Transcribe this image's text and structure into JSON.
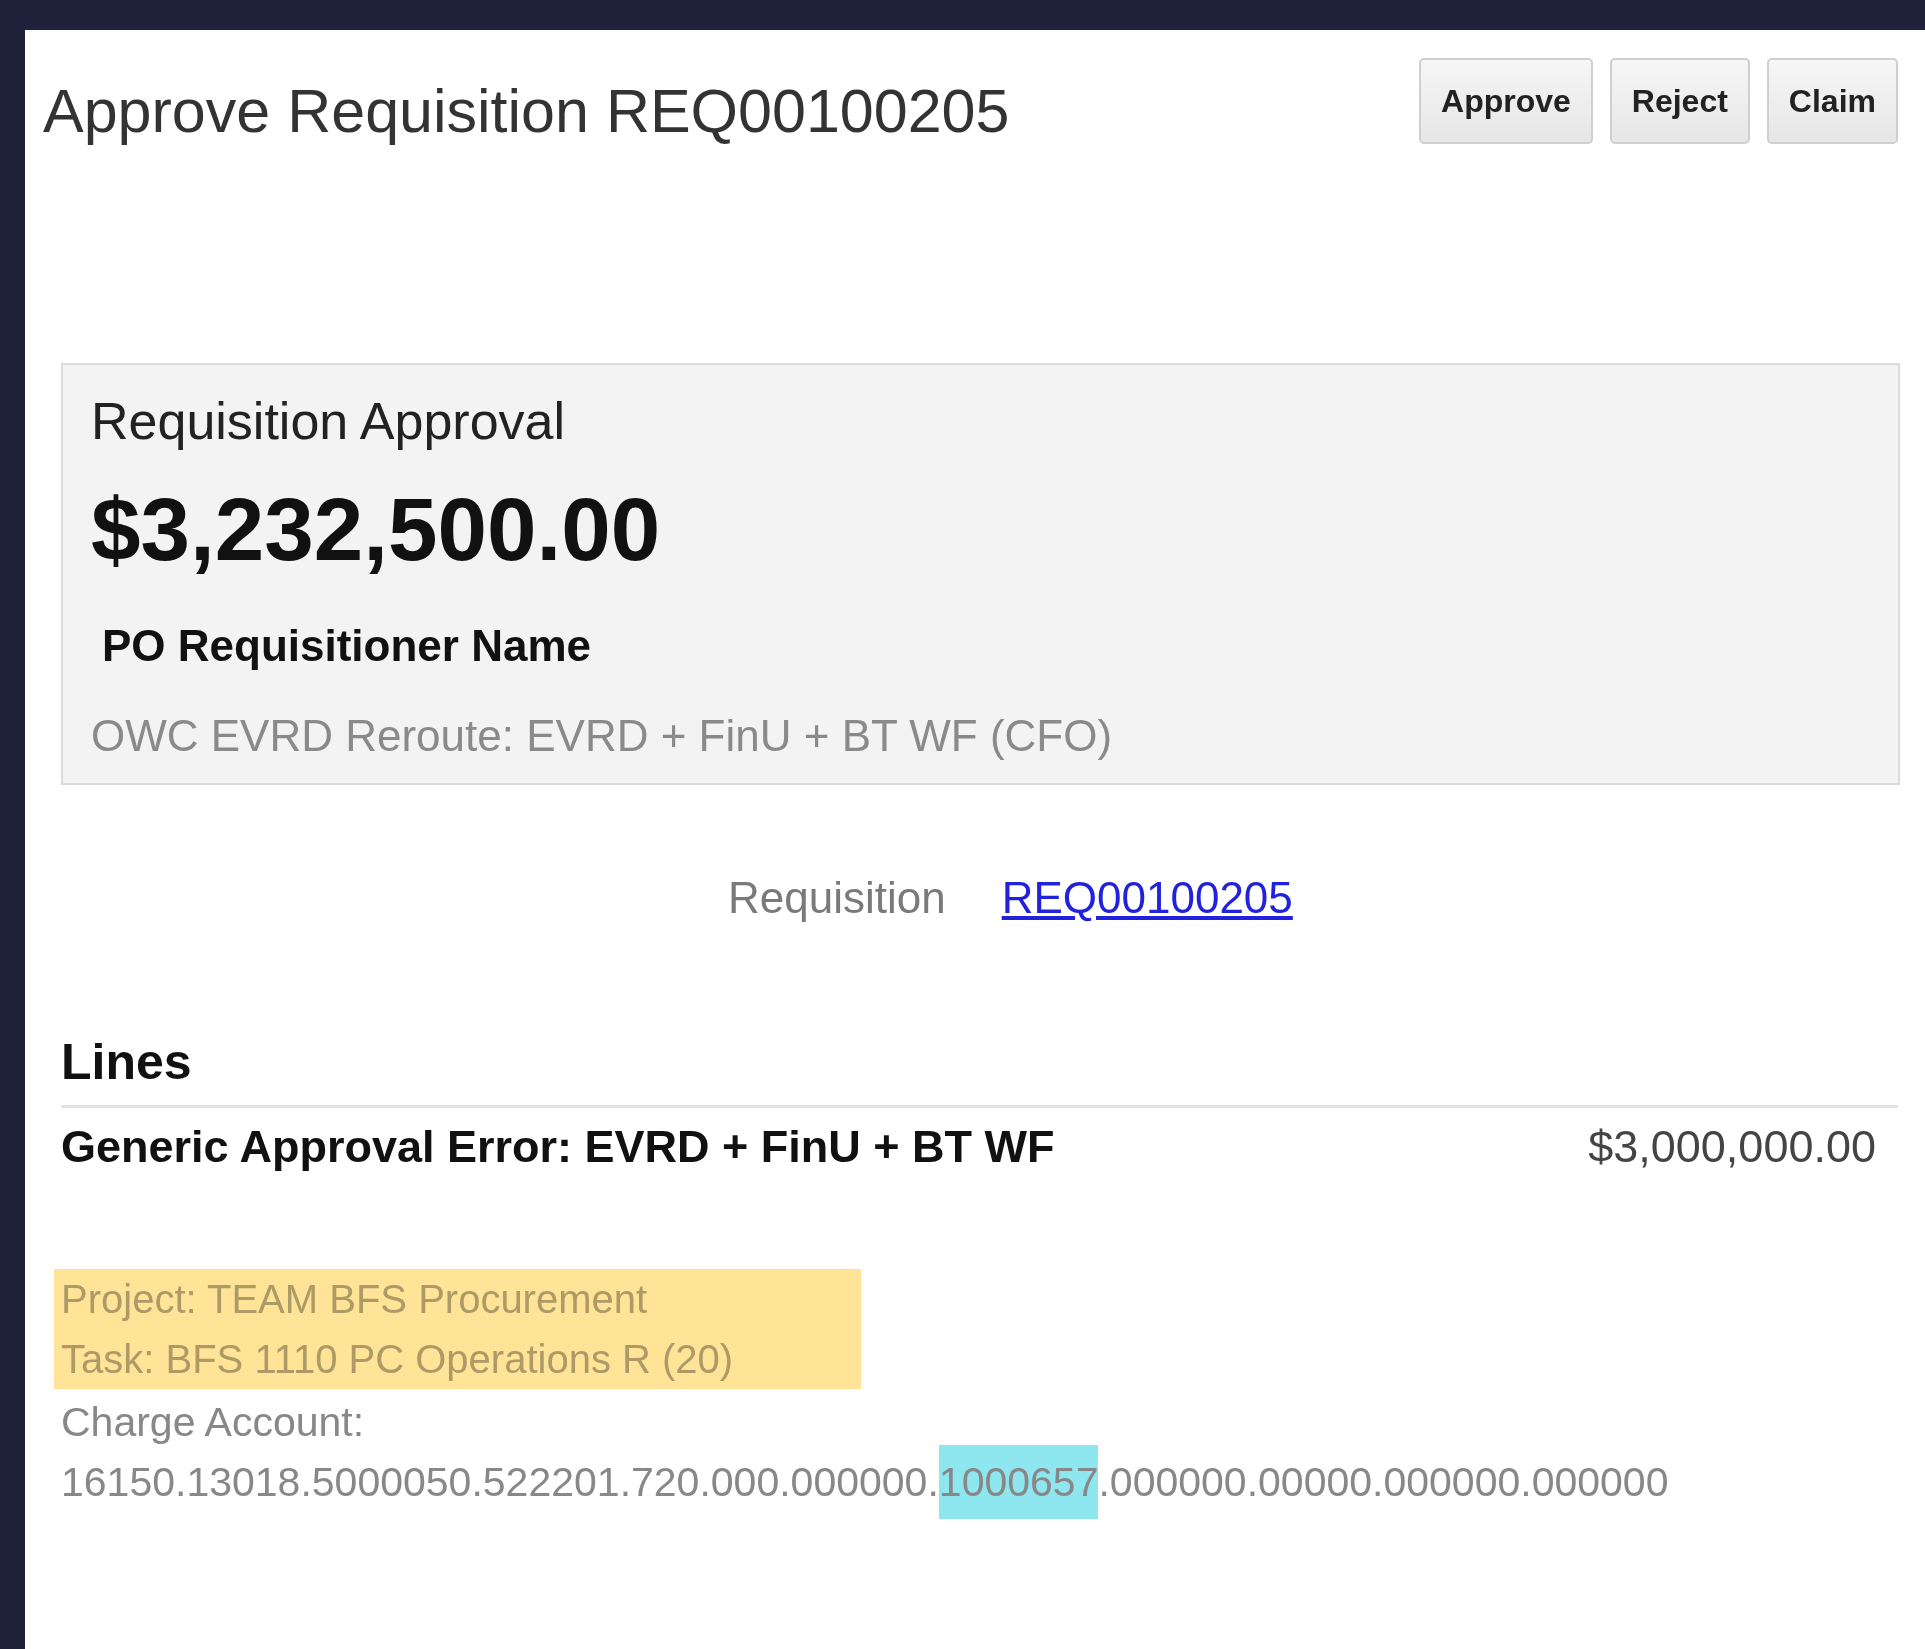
{
  "header": {
    "title": "Approve Requisition REQ00100205",
    "buttons": [
      "Approve",
      "Reject",
      "Claim"
    ]
  },
  "summary_card": {
    "title": "Requisition Approval",
    "amount": "$3,232,500.00",
    "requisitioner_label": "PO Requisitioner Name",
    "route": "OWC EVRD Reroute: EVRD + FinU + BT WF (CFO)"
  },
  "requisition": {
    "label": "Requisition",
    "link": "REQ00100205"
  },
  "lines": {
    "heading": "Lines",
    "items": [
      {
        "description": "Generic Approval Error: EVRD + FinU + BT WF",
        "amount": "$3,000,000.00",
        "details": [
          {
            "text": "Project: TEAM BFS Procurement",
            "highlighted": true
          },
          {
            "text": "Task: BFS 1110 PC Operations R (20)",
            "highlighted": true
          }
        ],
        "charge_account": {
          "label": "Charge Account:",
          "segments": [
            {
              "text": "16150.13018.5000050.522201.720.000.000000.",
              "highlighted": false
            },
            {
              "text": "1000657",
              "highlighted": true
            },
            {
              "text": ".000000.00000.000000.000000",
              "highlighted": false
            }
          ]
        }
      }
    ]
  }
}
